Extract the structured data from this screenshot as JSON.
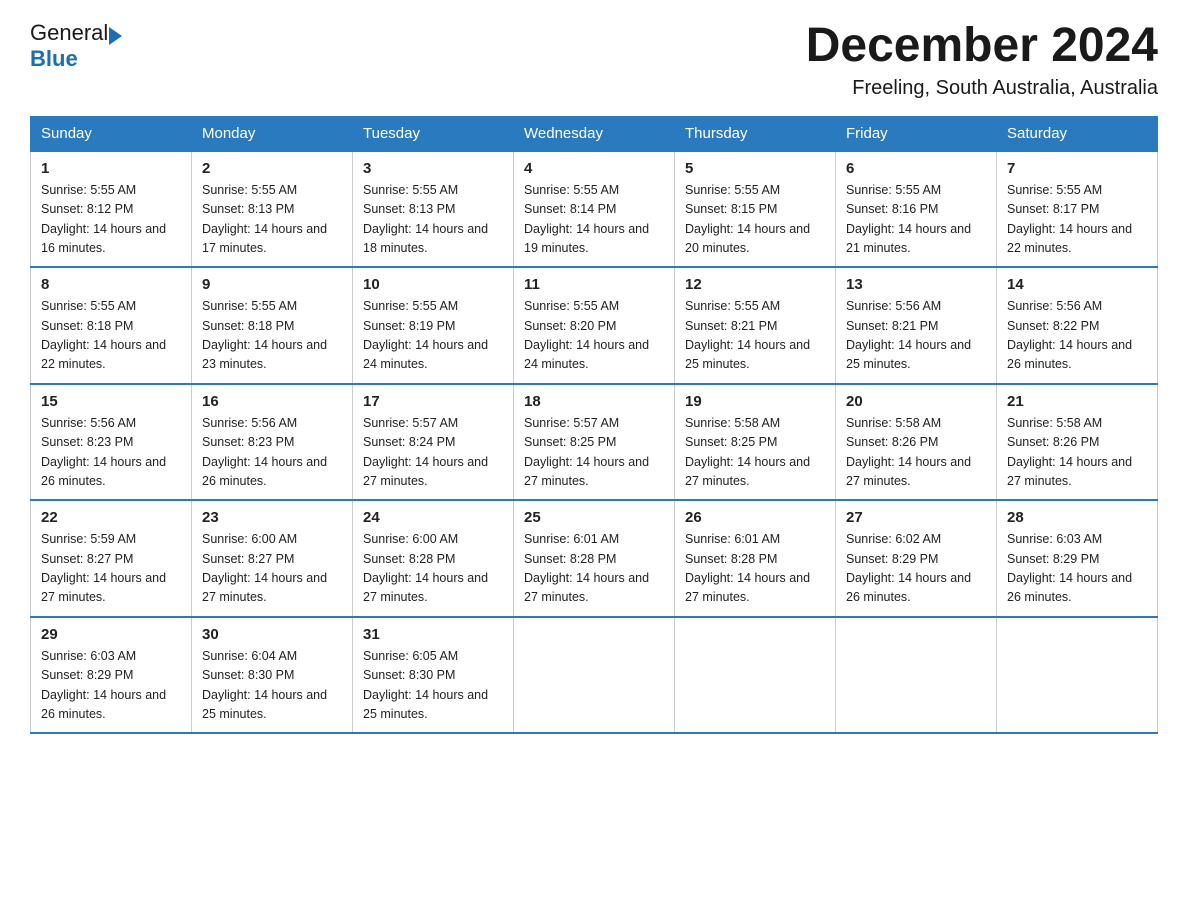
{
  "logo": {
    "general": "General",
    "arrow": "▶",
    "blue": "Blue"
  },
  "title": "December 2024",
  "subtitle": "Freeling, South Australia, Australia",
  "days_header": [
    "Sunday",
    "Monday",
    "Tuesday",
    "Wednesday",
    "Thursday",
    "Friday",
    "Saturday"
  ],
  "weeks": [
    [
      {
        "day": "1",
        "sunrise": "5:55 AM",
        "sunset": "8:12 PM",
        "daylight": "14 hours and 16 minutes."
      },
      {
        "day": "2",
        "sunrise": "5:55 AM",
        "sunset": "8:13 PM",
        "daylight": "14 hours and 17 minutes."
      },
      {
        "day": "3",
        "sunrise": "5:55 AM",
        "sunset": "8:13 PM",
        "daylight": "14 hours and 18 minutes."
      },
      {
        "day": "4",
        "sunrise": "5:55 AM",
        "sunset": "8:14 PM",
        "daylight": "14 hours and 19 minutes."
      },
      {
        "day": "5",
        "sunrise": "5:55 AM",
        "sunset": "8:15 PM",
        "daylight": "14 hours and 20 minutes."
      },
      {
        "day": "6",
        "sunrise": "5:55 AM",
        "sunset": "8:16 PM",
        "daylight": "14 hours and 21 minutes."
      },
      {
        "day": "7",
        "sunrise": "5:55 AM",
        "sunset": "8:17 PM",
        "daylight": "14 hours and 22 minutes."
      }
    ],
    [
      {
        "day": "8",
        "sunrise": "5:55 AM",
        "sunset": "8:18 PM",
        "daylight": "14 hours and 22 minutes."
      },
      {
        "day": "9",
        "sunrise": "5:55 AM",
        "sunset": "8:18 PM",
        "daylight": "14 hours and 23 minutes."
      },
      {
        "day": "10",
        "sunrise": "5:55 AM",
        "sunset": "8:19 PM",
        "daylight": "14 hours and 24 minutes."
      },
      {
        "day": "11",
        "sunrise": "5:55 AM",
        "sunset": "8:20 PM",
        "daylight": "14 hours and 24 minutes."
      },
      {
        "day": "12",
        "sunrise": "5:55 AM",
        "sunset": "8:21 PM",
        "daylight": "14 hours and 25 minutes."
      },
      {
        "day": "13",
        "sunrise": "5:56 AM",
        "sunset": "8:21 PM",
        "daylight": "14 hours and 25 minutes."
      },
      {
        "day": "14",
        "sunrise": "5:56 AM",
        "sunset": "8:22 PM",
        "daylight": "14 hours and 26 minutes."
      }
    ],
    [
      {
        "day": "15",
        "sunrise": "5:56 AM",
        "sunset": "8:23 PM",
        "daylight": "14 hours and 26 minutes."
      },
      {
        "day": "16",
        "sunrise": "5:56 AM",
        "sunset": "8:23 PM",
        "daylight": "14 hours and 26 minutes."
      },
      {
        "day": "17",
        "sunrise": "5:57 AM",
        "sunset": "8:24 PM",
        "daylight": "14 hours and 27 minutes."
      },
      {
        "day": "18",
        "sunrise": "5:57 AM",
        "sunset": "8:25 PM",
        "daylight": "14 hours and 27 minutes."
      },
      {
        "day": "19",
        "sunrise": "5:58 AM",
        "sunset": "8:25 PM",
        "daylight": "14 hours and 27 minutes."
      },
      {
        "day": "20",
        "sunrise": "5:58 AM",
        "sunset": "8:26 PM",
        "daylight": "14 hours and 27 minutes."
      },
      {
        "day": "21",
        "sunrise": "5:58 AM",
        "sunset": "8:26 PM",
        "daylight": "14 hours and 27 minutes."
      }
    ],
    [
      {
        "day": "22",
        "sunrise": "5:59 AM",
        "sunset": "8:27 PM",
        "daylight": "14 hours and 27 minutes."
      },
      {
        "day": "23",
        "sunrise": "6:00 AM",
        "sunset": "8:27 PM",
        "daylight": "14 hours and 27 minutes."
      },
      {
        "day": "24",
        "sunrise": "6:00 AM",
        "sunset": "8:28 PM",
        "daylight": "14 hours and 27 minutes."
      },
      {
        "day": "25",
        "sunrise": "6:01 AM",
        "sunset": "8:28 PM",
        "daylight": "14 hours and 27 minutes."
      },
      {
        "day": "26",
        "sunrise": "6:01 AM",
        "sunset": "8:28 PM",
        "daylight": "14 hours and 27 minutes."
      },
      {
        "day": "27",
        "sunrise": "6:02 AM",
        "sunset": "8:29 PM",
        "daylight": "14 hours and 26 minutes."
      },
      {
        "day": "28",
        "sunrise": "6:03 AM",
        "sunset": "8:29 PM",
        "daylight": "14 hours and 26 minutes."
      }
    ],
    [
      {
        "day": "29",
        "sunrise": "6:03 AM",
        "sunset": "8:29 PM",
        "daylight": "14 hours and 26 minutes."
      },
      {
        "day": "30",
        "sunrise": "6:04 AM",
        "sunset": "8:30 PM",
        "daylight": "14 hours and 25 minutes."
      },
      {
        "day": "31",
        "sunrise": "6:05 AM",
        "sunset": "8:30 PM",
        "daylight": "14 hours and 25 minutes."
      },
      null,
      null,
      null,
      null
    ]
  ]
}
